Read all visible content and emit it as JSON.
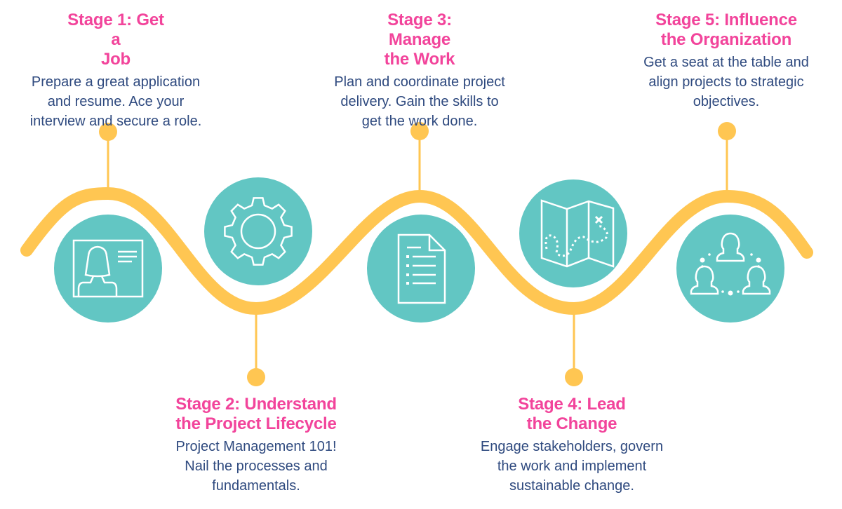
{
  "colors": {
    "title": "#F2449B",
    "body": "#2F4A7F",
    "wave": "#FFC652",
    "circle": "#62C6C3",
    "icon": "#FFFFFF"
  },
  "stages": [
    {
      "id": 1,
      "title_lines": [
        "Stage 1: Get a",
        "Job"
      ],
      "desc_lines": [
        "Prepare a great application",
        "and resume. Ace your",
        "interview and secure a role."
      ],
      "icon": "profile-card-icon",
      "position": "top"
    },
    {
      "id": 2,
      "title_lines": [
        "Stage 2: Understand",
        "the Project Lifecycle"
      ],
      "desc_lines": [
        "Project Management 101!",
        "Nail the processes and",
        "fundamentals."
      ],
      "icon": "gear-icon",
      "position": "bottom"
    },
    {
      "id": 3,
      "title_lines": [
        "Stage 3: Manage",
        "the Work"
      ],
      "desc_lines": [
        "Plan and coordinate project",
        "delivery. Gain the skills to",
        "get the work done."
      ],
      "icon": "document-list-icon",
      "position": "top"
    },
    {
      "id": 4,
      "title_lines": [
        "Stage 4: Lead",
        "the Change"
      ],
      "desc_lines": [
        "Engage stakeholders, govern",
        "the work and implement",
        "sustainable change."
      ],
      "icon": "treasure-map-icon",
      "position": "bottom"
    },
    {
      "id": 5,
      "title_lines": [
        "Stage 5: Influence",
        "the Organization"
      ],
      "desc_lines": [
        "Get a seat at the table and",
        "align projects to strategic",
        "objectives."
      ],
      "icon": "team-network-icon",
      "position": "top"
    }
  ]
}
